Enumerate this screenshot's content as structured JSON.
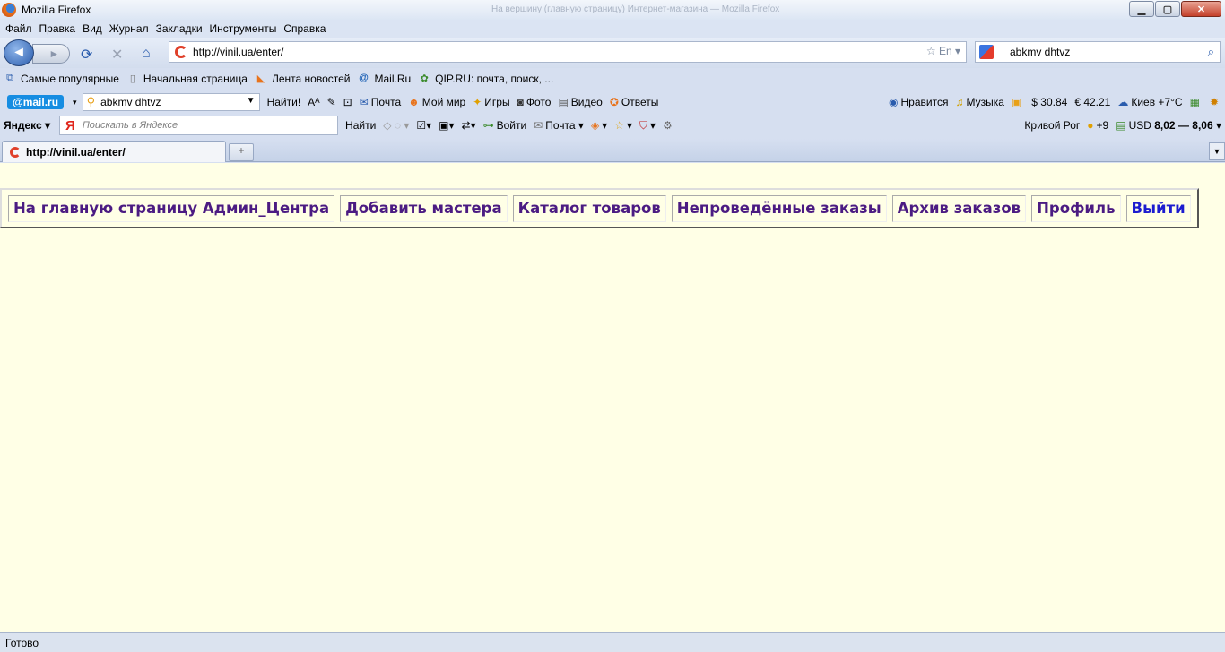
{
  "window": {
    "title": "Mozilla Firefox",
    "ghost_title": "На вершину (главную страницу) Интернет-магазина — Mozilla Firefox"
  },
  "menu": [
    "Файл",
    "Правка",
    "Вид",
    "Журнал",
    "Закладки",
    "Инструменты",
    "Справка"
  ],
  "navigation": {
    "url": "http://vinil.ua/enter/",
    "search_value": "abkmv dhtvz",
    "lang_badge": "En"
  },
  "bookmarks": [
    {
      "label": "Самые популярные",
      "icon": "popular-icon"
    },
    {
      "label": "Начальная страница",
      "icon": "page-icon"
    },
    {
      "label": "Лента новостей",
      "icon": "rss-icon"
    },
    {
      "label": "Mail.Ru",
      "icon": "at-icon"
    },
    {
      "label": "QIP.RU: почта, поиск, ...",
      "icon": "qip-icon"
    }
  ],
  "mail_toolbar": {
    "logo": "@mail.ru",
    "search_value": "abkmv dhtvz",
    "find_button": "Найти!",
    "left_items": [
      "Почта",
      "Мой мир",
      "Игры",
      "Фото",
      "Видео",
      "Ответы"
    ],
    "right_items": [
      "Нравится",
      "Музыка",
      "$ 30.84",
      "€ 42.21",
      "Киев +7°C"
    ]
  },
  "yandex_toolbar": {
    "logo": "Яндекс",
    "search_placeholder": "Поискать в Яндексе",
    "find_button": "Найти",
    "login": "Войти",
    "mail": "Почта",
    "city": "Кривой Рог",
    "weather": "+9",
    "currency_label": "USD",
    "currency_value": "8,02 — 8,06"
  },
  "tab": {
    "title": "http://vinil.ua/enter/"
  },
  "page": {
    "nav": [
      {
        "label": "На главную страницу Админ_Центра"
      },
      {
        "label": "Добавить мастера"
      },
      {
        "label": "Каталог товаров"
      },
      {
        "label": "Непроведённые заказы"
      },
      {
        "label": "Архив заказов"
      },
      {
        "label": "Профиль"
      },
      {
        "label": "Выйти"
      }
    ]
  },
  "status": {
    "text": "Готово"
  },
  "colors": {
    "page_bg": "#ffffe6",
    "nav_link": "#4b1b82",
    "exit_link": "#1c1ccf"
  }
}
